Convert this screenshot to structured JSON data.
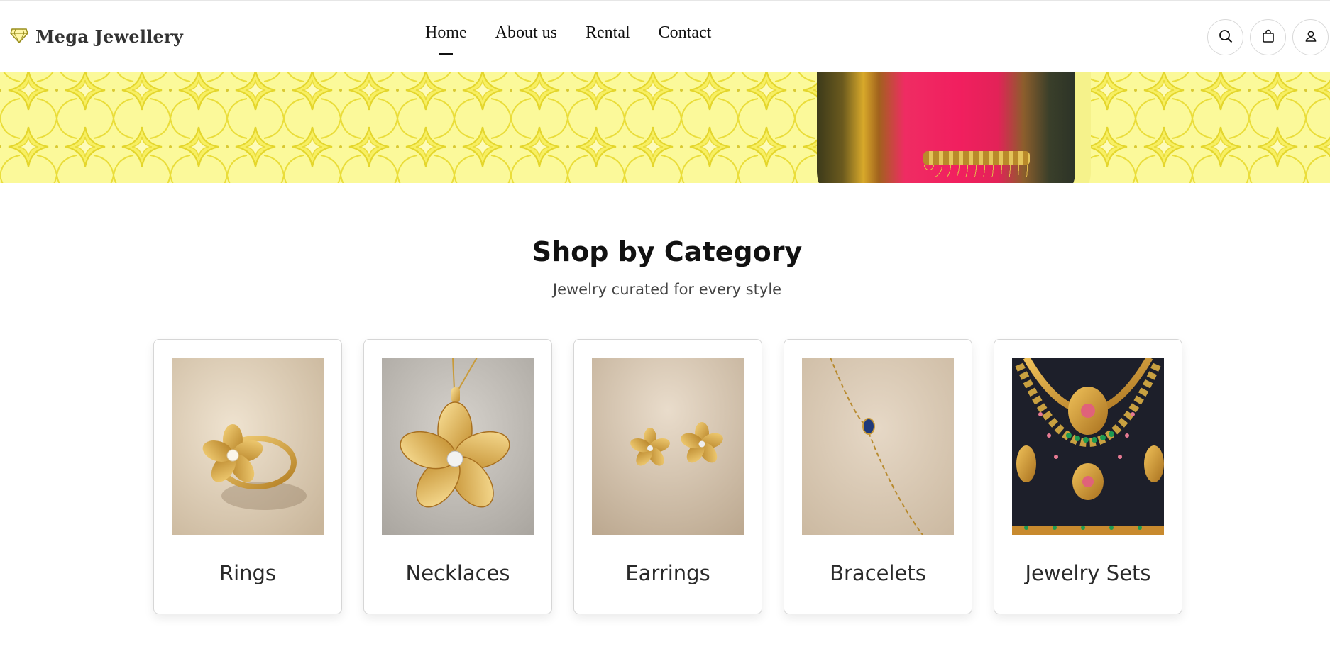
{
  "header": {
    "brand": "Mega Jewellery",
    "brand_icon": "diamond-icon",
    "nav": [
      {
        "label": "Home",
        "active": true
      },
      {
        "label": "About us",
        "active": false
      },
      {
        "label": "Rental",
        "active": false
      },
      {
        "label": "Contact",
        "active": false
      }
    ],
    "actions": [
      "search-icon",
      "shopping-bag-icon",
      "user-icon"
    ]
  },
  "banner": {
    "background_color": "#fbf99a",
    "pattern_color": "#efe23a"
  },
  "categories_section": {
    "title": "Shop by Category",
    "subtitle": "Jewelry curated for every style",
    "items": [
      {
        "label": "Rings",
        "image": "gold-flower-ring-with-pearl"
      },
      {
        "label": "Necklaces",
        "image": "gold-flower-pendant-necklace"
      },
      {
        "label": "Earrings",
        "image": "gold-flower-stud-earrings"
      },
      {
        "label": "Bracelets",
        "image": "gold-chain-bracelet-with-blue-stone"
      },
      {
        "label": "Jewelry Sets",
        "image": "gold-ruby-emerald-necklace-set"
      }
    ]
  }
}
